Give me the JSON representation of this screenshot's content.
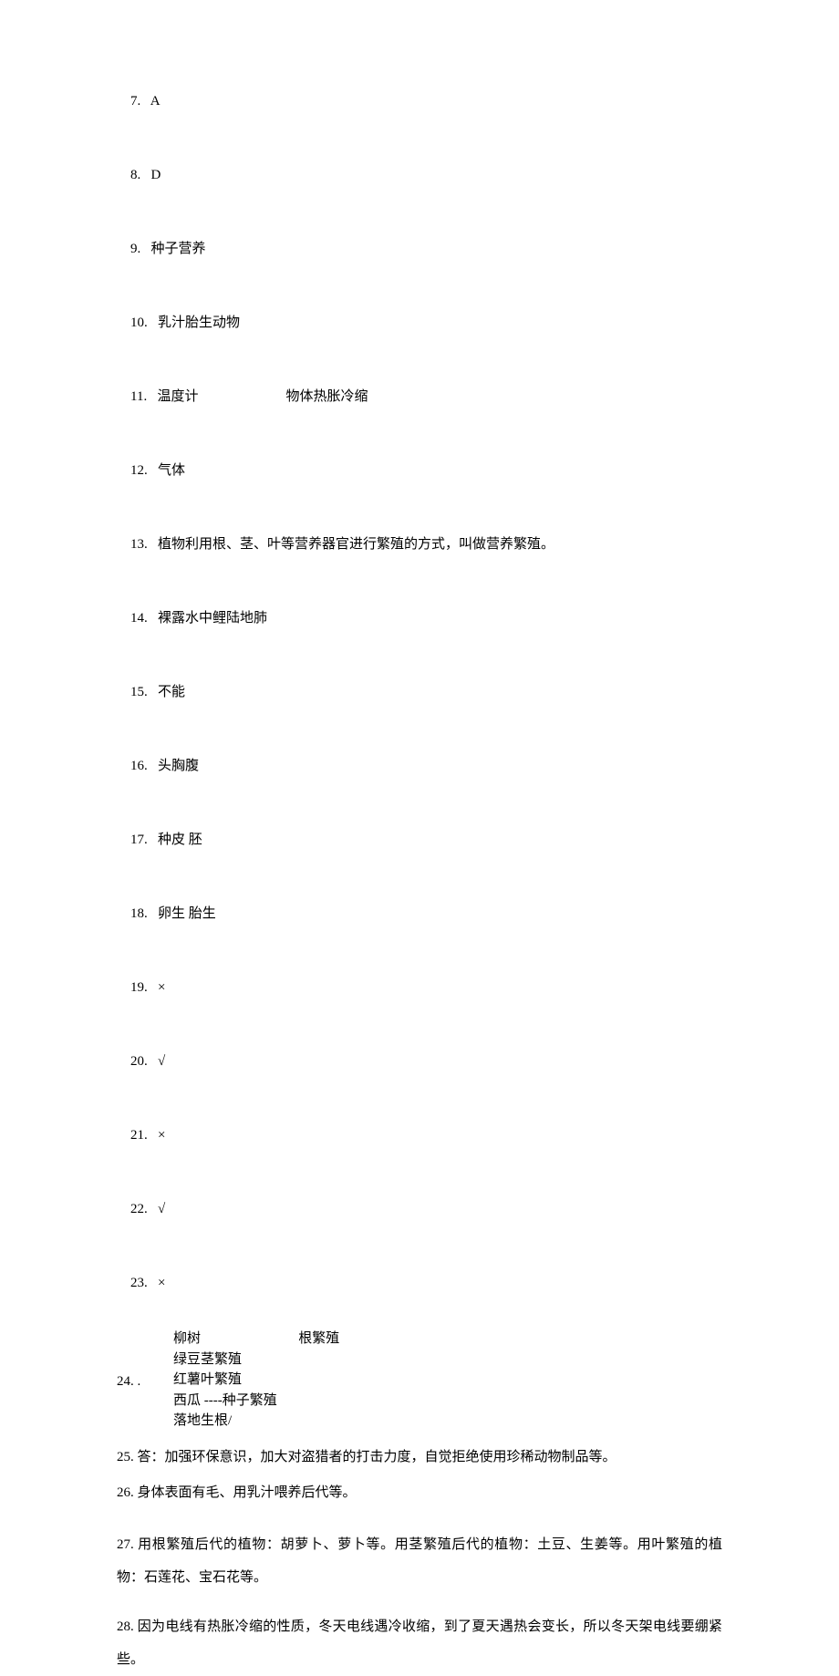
{
  "answers": {
    "a7": {
      "num": "7.   ",
      "text": "A"
    },
    "a8": {
      "num": "8.   ",
      "text": "D"
    },
    "a9": {
      "num": "9.   ",
      "text": "种子营养"
    },
    "a10": {
      "num": "10.   ",
      "text": "乳汁胎生动物"
    },
    "a11": {
      "num": "11.   ",
      "text1": "温度计",
      "text2": "物体热胀冷缩"
    },
    "a12": {
      "num": "12.   ",
      "text": "气体"
    },
    "a13": {
      "num": "13.   ",
      "text": "植物利用根、茎、叶等营养器官进行繁殖的方式，叫做营养繁殖。"
    },
    "a14": {
      "num": "14.   ",
      "text": "裸露水中鲤陆地肺"
    },
    "a15": {
      "num": "15.   ",
      "text": "不能"
    },
    "a16": {
      "num": "16.   ",
      "text": "头胸腹"
    },
    "a17": {
      "num": "17.   ",
      "text": "种皮 胚"
    },
    "a18": {
      "num": "18.   ",
      "text": "卵生 胎生"
    },
    "a19": {
      "num": "19.   ",
      "text": "×"
    },
    "a20": {
      "num": "20.   ",
      "text": "√"
    },
    "a21": {
      "num": "21.   ",
      "text": "×"
    },
    "a22": {
      "num": "22.   ",
      "text": "√"
    },
    "a23": {
      "num": "23.   ",
      "text": "×"
    },
    "a24": {
      "num": "24.   .",
      "rows": {
        "r1a": "柳树",
        "r1b": "根繁殖",
        "r2": "绿豆茎繁殖",
        "r3": "红薯叶繁殖",
        "r4": "西瓜 ----种子繁殖",
        "r5": "落地生根/"
      }
    },
    "a25": {
      "num": "25.   ",
      "text": "答：加强环保意识，加大对盗猎者的打击力度，自觉拒绝使用珍稀动物制品等。"
    },
    "a26": {
      "num": "26.   ",
      "text": "身体表面有毛、用乳汁喂养后代等。"
    },
    "a27": {
      "num": "27.   ",
      "text": "用根繁殖后代的植物：胡萝卜、萝卜等。用茎繁殖后代的植物：土豆、生姜等。用叶繁殖的植物：石莲花、宝石花等。"
    },
    "a28": {
      "num": "28.   ",
      "text": "因为电线有热胀冷缩的性质，冬天电线遇冷收缩，到了夏天遇热会变长，所以冬天架电线要绷紧些。"
    }
  }
}
